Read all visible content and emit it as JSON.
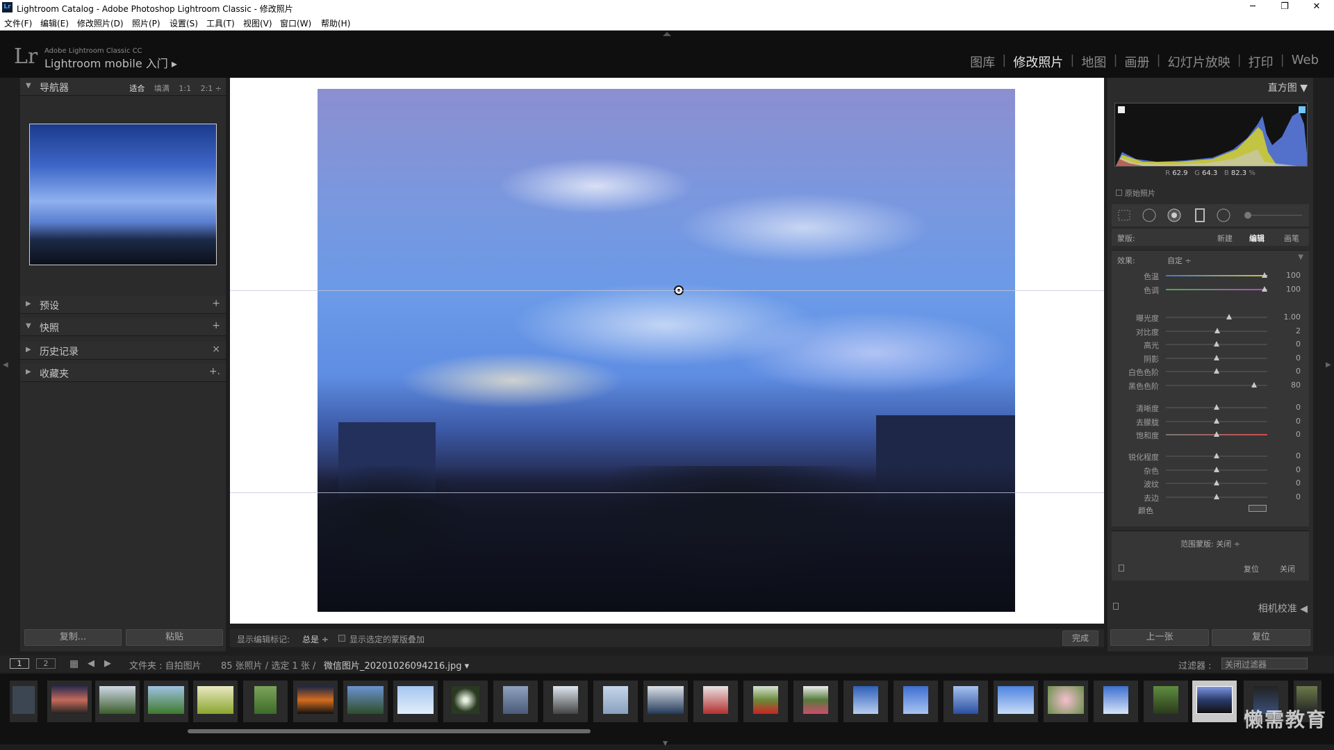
{
  "window": {
    "title": "Lightroom Catalog - Adobe Photoshop Lightroom Classic - 修改照片",
    "logo": "Lr",
    "controls": [
      "─",
      "❐",
      "✕"
    ]
  },
  "menu": [
    "文件(F)",
    "编辑(E)",
    "修改照片(D)",
    "照片(P)",
    "设置(S)",
    "工具(T)",
    "视图(V)",
    "窗口(W)",
    "帮助(H)"
  ],
  "identity": {
    "logo": "Lr",
    "line1": "Adobe Lightroom Classic CC",
    "line2": "Lightroom mobile 入门  ▸"
  },
  "modules": {
    "library": "图库",
    "develop": "修改照片",
    "map": "地图",
    "book": "画册",
    "slideshow": "幻灯片放映",
    "print": "打印",
    "web": "Web",
    "separator": "|"
  },
  "left": {
    "navigator": {
      "label": "导航器",
      "zoom": [
        "适合",
        "填满",
        "1:1",
        "2:1 ÷"
      ]
    },
    "presets": {
      "label": "预设",
      "action": "+"
    },
    "snapshots": {
      "label": "快照",
      "action": "+"
    },
    "history": {
      "label": "历史记录",
      "action": "×"
    },
    "collections": {
      "label": "收藏夹",
      "action": "+."
    },
    "copy_btn": "复制...",
    "paste_btn": "粘贴"
  },
  "toolbar": {
    "show_pins_label": "显示编辑标记:",
    "show_pins_value": "总是 ÷",
    "overlay_label": "显示选定的蒙版叠加",
    "done": "完成"
  },
  "right": {
    "histogram_label": "直方图  ▼",
    "readout": {
      "r_label": "R",
      "r": "62.9",
      "g_label": "G",
      "g": "64.3",
      "b_label": "B",
      "b": "82.3",
      "pct": "%"
    },
    "original_photo": "原始照片",
    "mask": {
      "label": "蒙版:",
      "new": "新建",
      "edit": "编辑",
      "brush": "画笔"
    },
    "effect": {
      "label": "效果:",
      "value": "自定 ÷"
    },
    "sliders_a": [
      {
        "label": "色温",
        "value": "100",
        "pos": 0.97
      },
      {
        "label": "色调",
        "value": "100",
        "pos": 0.97
      }
    ],
    "sliders_b": [
      {
        "label": "曝光度",
        "value": "1.00",
        "pos": 0.62
      },
      {
        "label": "对比度",
        "value": "2",
        "pos": 0.51
      },
      {
        "label": "高光",
        "value": "0",
        "pos": 0.5
      },
      {
        "label": "阴影",
        "value": "0",
        "pos": 0.5
      },
      {
        "label": "白色色阶",
        "value": "0",
        "pos": 0.5
      },
      {
        "label": "黑色色阶",
        "value": "80",
        "pos": 0.87
      }
    ],
    "sliders_c": [
      {
        "label": "清晰度",
        "value": "0",
        "pos": 0.5
      },
      {
        "label": "去朦胧",
        "value": "0",
        "pos": 0.5
      },
      {
        "label": "饱和度",
        "value": "0",
        "pos": 0.5
      }
    ],
    "sliders_d": [
      {
        "label": "锐化程度",
        "value": "0",
        "pos": 0.5
      },
      {
        "label": "杂色",
        "value": "0",
        "pos": 0.5
      },
      {
        "label": "波纹",
        "value": "0",
        "pos": 0.5
      },
      {
        "label": "去边",
        "value": "0",
        "pos": 0.5
      }
    ],
    "color_label": "颜色",
    "range_mask": "范围蒙版:  关闭 ÷",
    "reset": "复位",
    "close": "关闭",
    "camera_calibration": "相机校准  ◀",
    "prev_btn": "上一张",
    "reset_btn": "复位"
  },
  "filmbar": {
    "page1": "1",
    "page2": "2",
    "source": "文件夹 : 自拍图片",
    "count": "85 张照片 / 选定 1 张 /",
    "filename": "微信图片_20201026094216.jpg ▾",
    "filter_label": "过滤器 :",
    "filter_value": "关闭过滤器"
  },
  "watermark": "懒需教育",
  "colors": {
    "accent": "#e6e6e6",
    "panel": "#2b2b2b",
    "bg": "#1e1e1e"
  }
}
